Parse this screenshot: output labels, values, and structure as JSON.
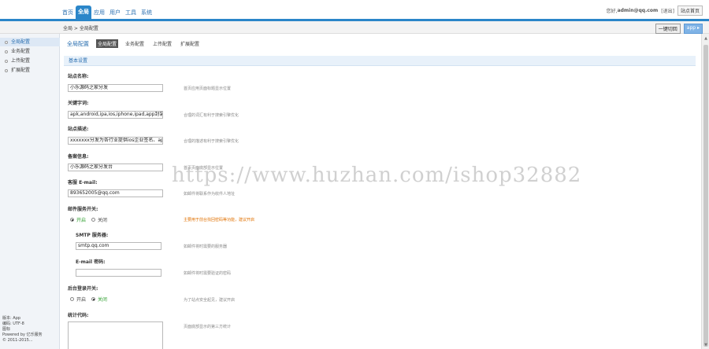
{
  "topnav": {
    "items": [
      {
        "label": "首页",
        "active": false
      },
      {
        "label": "全局",
        "active": true
      },
      {
        "label": "应用",
        "active": false
      },
      {
        "label": "用户",
        "active": false
      },
      {
        "label": "工具",
        "active": false
      },
      {
        "label": "系统",
        "active": false
      }
    ],
    "greeting": "您好,",
    "user": "admin@qq.com",
    "logout": "[退出]",
    "home_button": "站点首页"
  },
  "breadcrumb": {
    "text": "全局 > 全局配置",
    "button_refresh": "一键切回",
    "button_app": "app ▸"
  },
  "sidebar": {
    "items": [
      {
        "label": "全局配置",
        "active": true
      },
      {
        "label": "业务配置",
        "active": false
      },
      {
        "label": "上传配置",
        "active": false
      },
      {
        "label": "扩展配置",
        "active": false
      }
    ],
    "footer": [
      "版本: App",
      "编码: UTF-8",
      "图标",
      "Powered by 亿乐服务",
      "© 2011-2015..."
    ]
  },
  "tabs": {
    "title": "全局配置",
    "items": [
      {
        "label": "全局配置",
        "active": true
      },
      {
        "label": "业务配置",
        "active": false
      },
      {
        "label": "上传配置",
        "active": false
      },
      {
        "label": "扩展配置",
        "active": false
      }
    ]
  },
  "section": {
    "title": "基本设置"
  },
  "fields": {
    "site_name": {
      "label": "站点名称:",
      "value": "小乐源码之家分发",
      "hint": "首页应用页面标题显示位置"
    },
    "keywords": {
      "label": "关键字词:",
      "value": "apk,android,ipa,ios,iphone,ipad,app封装,上",
      "hint": "合理的词汇有利于搜索引擎优化"
    },
    "description": {
      "label": "站点描述:",
      "value": "xxxxxxx分发为各行业提供ios企业签名、app封",
      "hint": "合理的描述有利于搜索引擎优化"
    },
    "icp": {
      "label": "备案信息:",
      "value": "小乐源码之家分发台",
      "hint": "首页页面底部显示位置"
    },
    "email": {
      "label": "客服 E-mail:",
      "value": "893652005@qq.com",
      "hint": "如邮件将联系作为收件人地址"
    },
    "mail_switch": {
      "label": "邮件服务开关:",
      "on": "开启",
      "off": "关闭",
      "selected": "on",
      "hint": "主要用于前台找回密码等功能，建议开启"
    },
    "smtp": {
      "label": "SMTP 服务器:",
      "value": "smtp.qq.com",
      "hint": "如邮件将时需要的服务器"
    },
    "email_pwd": {
      "label": "E-mail 密码:",
      "value": "",
      "hint": "如邮件将时需要验证的密码"
    },
    "admin_switch": {
      "label": "后台登录开关:",
      "on": "开启",
      "off": "关闭",
      "selected": "off",
      "hint": "为了站点安全起见，建议开启"
    },
    "stats": {
      "label": "统计代码:",
      "hint": "页面底部显示的第三方统计"
    }
  },
  "watermark": "https://www.huzhan.com/ishop32882",
  "colors": {
    "accent": "#2b86c9",
    "link": "#2a6fb0",
    "orange": "#e07000",
    "green": "#2e9e2e"
  }
}
